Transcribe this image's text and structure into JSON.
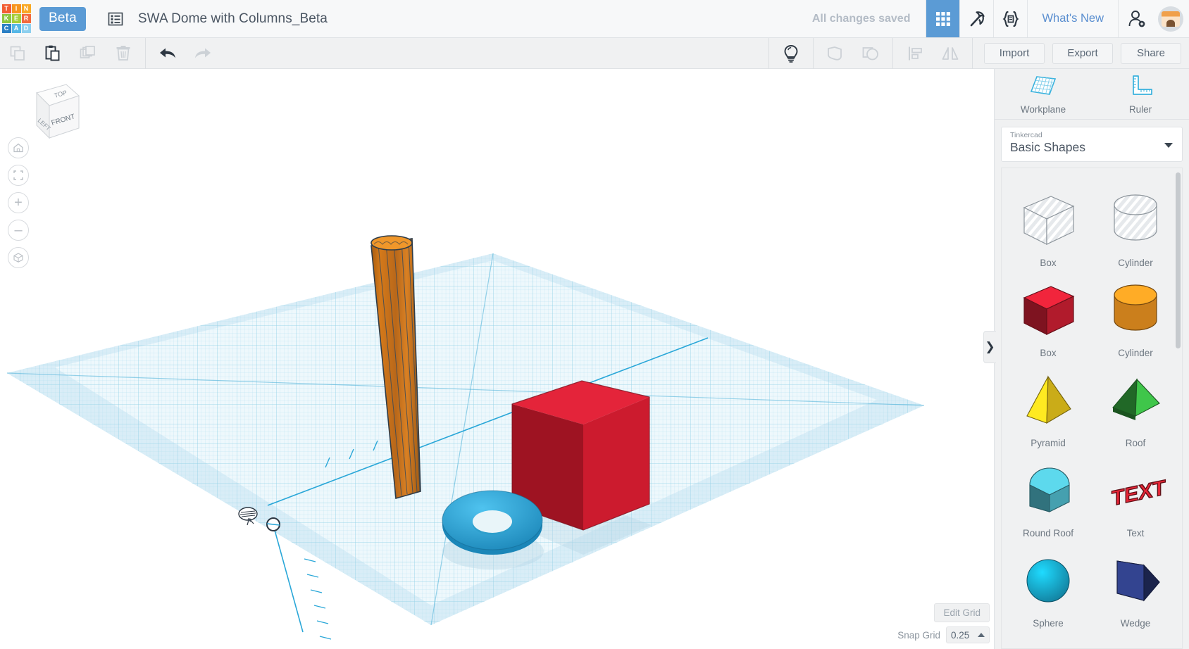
{
  "header": {
    "logo_name": "tinkercad-logo",
    "logo_cells": [
      {
        "letter": "T",
        "color": "#f25d33"
      },
      {
        "letter": "I",
        "color": "#f7941e"
      },
      {
        "letter": "N",
        "color": "#f9a825"
      },
      {
        "letter": "K",
        "color": "#8cc63f"
      },
      {
        "letter": "E",
        "color": "#a6ce39"
      },
      {
        "letter": "R",
        "color": "#f26a3e"
      },
      {
        "letter": "C",
        "color": "#2b7fc4"
      },
      {
        "letter": "A",
        "color": "#56b7e6"
      },
      {
        "letter": "D",
        "color": "#8ed0ef"
      }
    ],
    "beta_label": "Beta",
    "list_icon": "list-icon",
    "document_title": "SWA Dome with Columns_Beta",
    "save_status": "All changes saved",
    "buttons": [
      {
        "name": "blocks-grid-icon",
        "active": true
      },
      {
        "name": "pickaxe-icon",
        "active": false
      },
      {
        "name": "code-blocks-icon",
        "active": false
      }
    ],
    "whats_new_label": "What's New",
    "invite_icon": "add-person-icon",
    "avatar_name": "user-avatar",
    "accent_color": "#5b9bd5"
  },
  "toolbar": {
    "left_tools": [
      {
        "name": "copy-icon",
        "label": "Copy",
        "enabled": false
      },
      {
        "name": "paste-icon",
        "label": "Paste",
        "enabled": true
      },
      {
        "name": "duplicate-icon",
        "label": "Duplicate",
        "enabled": false
      },
      {
        "name": "delete-icon",
        "label": "Delete",
        "enabled": false
      }
    ],
    "history_tools": [
      {
        "name": "undo-icon",
        "label": "Undo",
        "enabled": true
      },
      {
        "name": "redo-icon",
        "label": "Redo",
        "enabled": false
      }
    ],
    "right_tools": [
      {
        "name": "lightbulb-icon",
        "label": "Notes",
        "enabled": true
      },
      {
        "name": "group-icon",
        "label": "Group",
        "enabled": false
      },
      {
        "name": "ungroup-icon",
        "label": "Ungroup",
        "enabled": false
      },
      {
        "name": "align-icon",
        "label": "Align",
        "enabled": false
      },
      {
        "name": "mirror-icon",
        "label": "Mirror",
        "enabled": false
      }
    ],
    "import_label": "Import",
    "export_label": "Export",
    "share_label": "Share"
  },
  "viewport": {
    "viewcube": {
      "name": "view-cube",
      "top_label": "TOP",
      "left_label": "LEFT",
      "front_label": "FRONT"
    },
    "nav_buttons": [
      {
        "name": "home-view-button",
        "glyph": "home"
      },
      {
        "name": "fit-to-view-button",
        "glyph": "fit"
      },
      {
        "name": "zoom-in-button",
        "glyph": "+"
      },
      {
        "name": "zoom-out-button",
        "glyph": "–"
      },
      {
        "name": "perspective-toggle-button",
        "glyph": "cube"
      }
    ],
    "grid_marker_icon": "workplane-marker-icon",
    "edit_grid_label": "Edit Grid",
    "snap_grid_label": "Snap Grid",
    "snap_grid_value": "0.25",
    "workplane_color": "#d6eef7",
    "objects": [
      {
        "name": "orange-fluted-column",
        "shape": "column",
        "color": "#d4791a"
      },
      {
        "name": "red-box",
        "shape": "box",
        "color": "#d81f34"
      },
      {
        "name": "blue-torus",
        "shape": "torus",
        "color": "#27a3d6"
      }
    ]
  },
  "sidebar": {
    "tools": [
      {
        "name": "workplane-tool",
        "label": "Workplane",
        "icon": "workplane-icon"
      },
      {
        "name": "ruler-tool",
        "label": "Ruler",
        "icon": "ruler-icon"
      }
    ],
    "library": {
      "owner": "Tinkercad",
      "collection": "Basic Shapes"
    },
    "shapes": [
      {
        "name": "shape-box-hole",
        "label": "Box",
        "kind": "box",
        "color": "#c9ced4",
        "hole": true
      },
      {
        "name": "shape-cylinder-hole",
        "label": "Cylinder",
        "kind": "cylinder",
        "color": "#c9ced4",
        "hole": true
      },
      {
        "name": "shape-box",
        "label": "Box",
        "kind": "box",
        "color": "#cc1f33",
        "hole": false
      },
      {
        "name": "shape-cylinder",
        "label": "Cylinder",
        "kind": "cylinder",
        "color": "#e99220",
        "hole": false
      },
      {
        "name": "shape-pyramid",
        "label": "Pyramid",
        "kind": "pyramid",
        "color": "#e8c61c",
        "hole": false
      },
      {
        "name": "shape-roof",
        "label": "Roof",
        "kind": "roof",
        "color": "#35a83f",
        "hole": false
      },
      {
        "name": "shape-round-roof",
        "label": "Round Roof",
        "kind": "round-roof",
        "color": "#4fb8c9",
        "hole": false
      },
      {
        "name": "shape-text",
        "label": "Text",
        "kind": "text",
        "color": "#c41f2e",
        "hole": false
      },
      {
        "name": "shape-sphere",
        "label": "Sphere",
        "kind": "sphere",
        "color": "#17a2cc",
        "hole": false
      },
      {
        "name": "shape-wedge",
        "label": "Wedge",
        "kind": "wedge",
        "color": "#2b3a7a",
        "hole": false
      }
    ],
    "panel_toggle_glyph": "❯"
  }
}
